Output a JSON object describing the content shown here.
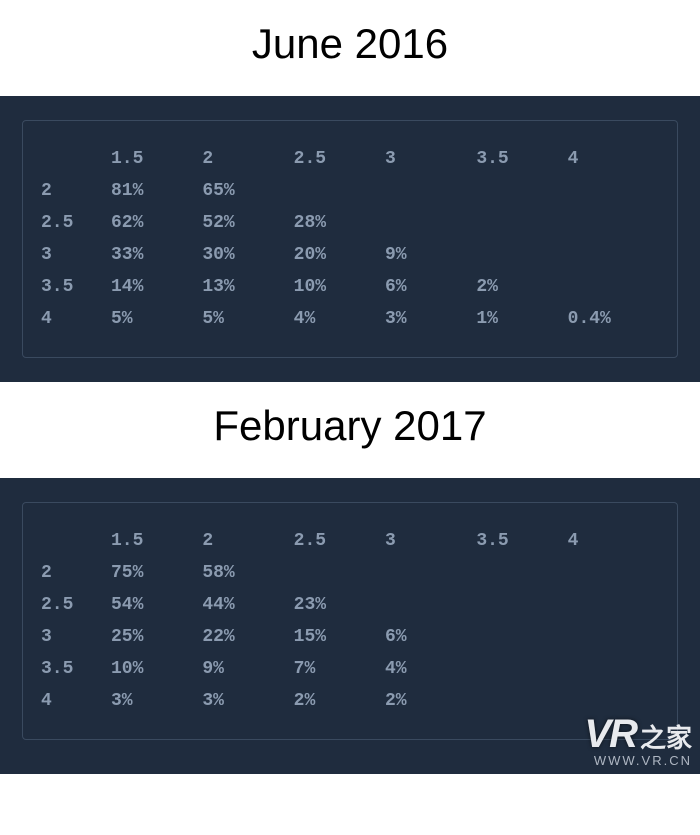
{
  "sections": [
    {
      "title": "June 2016",
      "columns": [
        "",
        "1.5",
        "2",
        "2.5",
        "3",
        "3.5",
        "4"
      ],
      "rows": [
        {
          "label": "2",
          "cells": [
            "81%",
            "65%",
            "",
            "",
            "",
            ""
          ]
        },
        {
          "label": "2.5",
          "cells": [
            "62%",
            "52%",
            "28%",
            "",
            "",
            ""
          ]
        },
        {
          "label": "3",
          "cells": [
            "33%",
            "30%",
            "20%",
            "9%",
            "",
            ""
          ]
        },
        {
          "label": "3.5",
          "cells": [
            "14%",
            "13%",
            "10%",
            "6%",
            "2%",
            ""
          ]
        },
        {
          "label": "4",
          "cells": [
            "5%",
            "5%",
            "4%",
            "3%",
            "1%",
            "0.4%"
          ]
        }
      ]
    },
    {
      "title": "February 2017",
      "columns": [
        "",
        "1.5",
        "2",
        "2.5",
        "3",
        "3.5",
        "4"
      ],
      "rows": [
        {
          "label": "2",
          "cells": [
            "75%",
            "58%",
            "",
            "",
            "",
            ""
          ]
        },
        {
          "label": "2.5",
          "cells": [
            "54%",
            "44%",
            "23%",
            "",
            "",
            ""
          ]
        },
        {
          "label": "3",
          "cells": [
            "25%",
            "22%",
            "15%",
            "6%",
            "",
            ""
          ]
        },
        {
          "label": "3.5",
          "cells": [
            "10%",
            "9%",
            "7%",
            "4%",
            "",
            ""
          ]
        },
        {
          "label": "4",
          "cells": [
            "3%",
            "3%",
            "2%",
            "2%",
            "",
            ""
          ]
        }
      ]
    }
  ],
  "watermark": {
    "brand_prefix": "VR",
    "brand_suffix": "之家",
    "url": "WWW.VR.CN"
  }
}
